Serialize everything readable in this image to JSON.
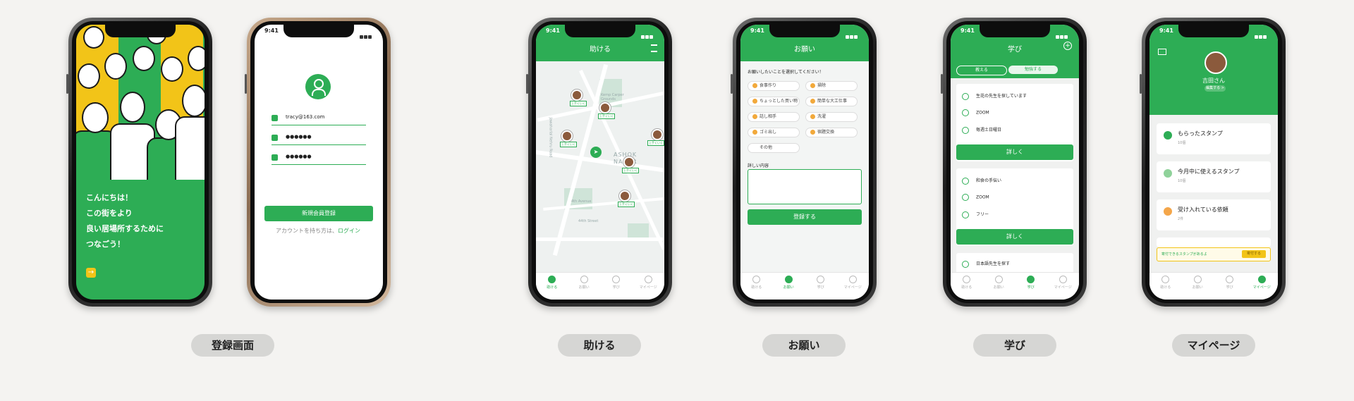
{
  "colors": {
    "primary": "#2dad55",
    "accent": "#f2c418",
    "background": "#f4f3f1"
  },
  "status_time": "9:41",
  "screens": {
    "register_intro": {
      "lines": [
        "こんにちは！",
        "この街をより",
        "良い居場所するために",
        "つなごう！"
      ],
      "arrow": "→"
    },
    "login": {
      "email": "tracy@163.com",
      "password1": "●●●●●●",
      "password2": "●●●●●●",
      "signup_button": "新規会員登録",
      "login_prompt": "アカウントを持ち方は、",
      "login_link": "ログイン"
    },
    "help": {
      "title": "助ける",
      "map_labels": {
        "ashok": "ASHOK",
        "nagar": "NAGAR",
        "avenue": "4th Avenue",
        "street": "44th Street",
        "kemp": "Kemp Carper Grounds",
        "rd": "Jawaharlal Nehru Road"
      },
      "pin_tags": [
        "上手くいく",
        "上手くいく",
        "上手くいく",
        "上手くいく",
        "上手くいく",
        "上手くいく"
      ]
    },
    "request": {
      "title": "お願い",
      "prompt": "お願いしたいことを選択してください！",
      "chips": [
        "食事作り",
        "掃除",
        "ちょっとした買い物",
        "簡単な大工仕事",
        "話し相手",
        "洗濯",
        "ゴミ出し",
        "宿題交換",
        "その他"
      ],
      "detail_label": "詳しい内容",
      "submit": "登録する"
    },
    "learn": {
      "title": "学び",
      "tabs": [
        "教える",
        "勉強する"
      ],
      "card1": [
        "生花の先生を探しています",
        "ZOOM",
        "毎週土日曜日"
      ],
      "card2": [
        "和食の手伝い",
        "ZOOM",
        "フリー"
      ],
      "card3": [
        "日本語先生を探す"
      ],
      "detail_button": "詳しく"
    },
    "mypage": {
      "name": "吉田さん",
      "edit": "編集する >",
      "items": [
        {
          "title": "もらったスタンプ",
          "sub": "10個"
        },
        {
          "title": "今月中に使えるスタンプ",
          "sub": "10個"
        },
        {
          "title": "受け入れている依頼",
          "sub": "2件"
        }
      ],
      "banner_text": "寄付できるスタンプがあるよ",
      "banner_button": "寄付する"
    }
  },
  "tabbar": [
    "助ける",
    "お願い",
    "学び",
    "マイページ"
  ],
  "labels": [
    "登録画面",
    "助ける",
    "お願い",
    "学び",
    "マイページ"
  ]
}
